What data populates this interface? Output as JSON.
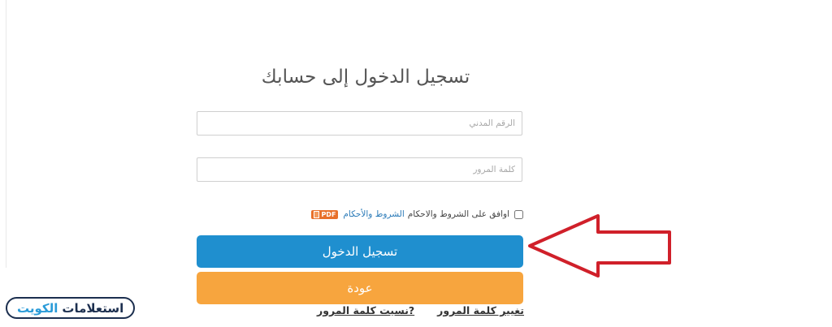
{
  "form": {
    "title": "تسجيل الدخول إلى حسابك",
    "civil_id_placeholder": "الرقم المدني",
    "password_placeholder": "كلمة المرور",
    "terms": {
      "agree_text": "اوافق على الشروط والاحكام",
      "link_text": "الشروط والأحكام",
      "pdf_badge": "PDF"
    },
    "login_button": "تسجيل الدخول",
    "back_button": "عودة",
    "change_password_link": "تغيير كلمة المرور",
    "forgot_password_link": "?نسيت كلمة المرور"
  },
  "watermark": {
    "word1": "استعلامات",
    "word2": "الكويت"
  },
  "colors": {
    "login": "#1f8fcf",
    "back": "#f7a53e",
    "arrow": "#d0202a",
    "badge_border": "#1c2f4f"
  },
  "icons": [
    "pdf-icon",
    "red-arrow-icon"
  ]
}
